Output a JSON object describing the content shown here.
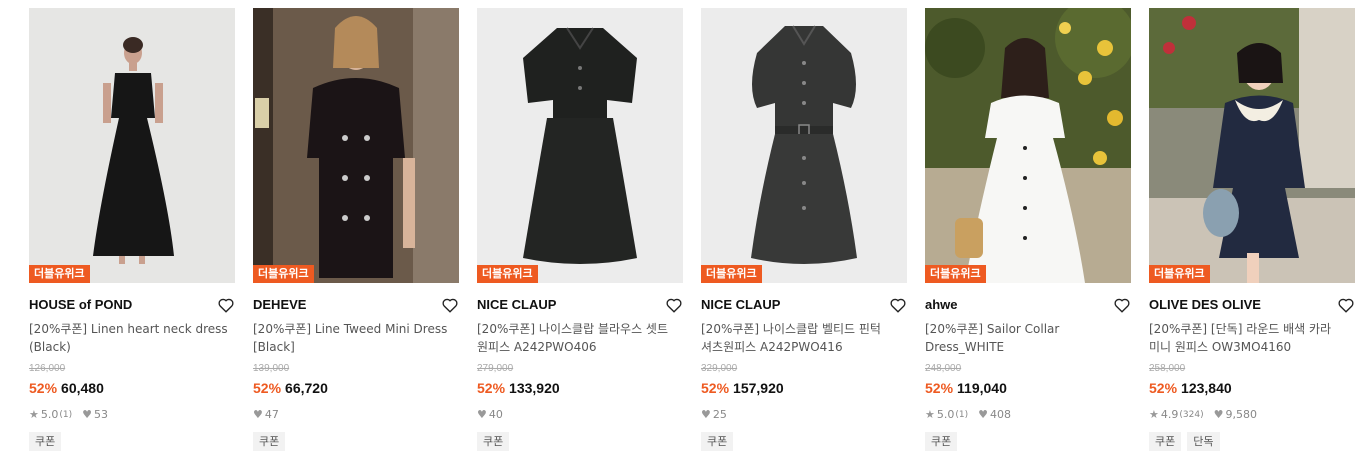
{
  "products": [
    {
      "badge": "더블유위크",
      "brand": "HOUSE of POND",
      "title_line1": "[20%쿠폰] Linen heart neck dress",
      "title_line2": "(Black)",
      "original_price": "126,000",
      "discount": "52%",
      "sale_price": "60,480",
      "rating": "5.0",
      "review_count": "(1)",
      "likes": "53",
      "tags": [
        "쿠폰"
      ],
      "image": "model-black-long-dress"
    },
    {
      "badge": "더블유위크",
      "brand": "DEHEVE",
      "title_line1": "[20%쿠폰] Line Tweed Mini Dress",
      "title_line2": "[Black]",
      "original_price": "139,000",
      "discount": "52%",
      "sale_price": "66,720",
      "rating": "",
      "review_count": "",
      "likes": "47",
      "tags": [
        "쿠폰"
      ],
      "image": "model-black-tweed-mini-dress"
    },
    {
      "badge": "더블유위크",
      "brand": "NICE CLAUP",
      "title_line1": "[20%쿠폰] 나이스클랍 블라우스 셋트",
      "title_line2": "원피스 A242PWO406",
      "original_price": "279,000",
      "discount": "52%",
      "sale_price": "133,920",
      "rating": "",
      "review_count": "",
      "likes": "40",
      "tags": [
        "쿠폰"
      ],
      "image": "product-black-blouse-set-dress"
    },
    {
      "badge": "더블유위크",
      "brand": "NICE CLAUP",
      "title_line1": "[20%쿠폰] 나이스클랍 벨티드 핀턱",
      "title_line2": "셔츠원피스 A242PWO416",
      "original_price": "329,000",
      "discount": "52%",
      "sale_price": "157,920",
      "rating": "",
      "review_count": "",
      "likes": "25",
      "tags": [
        "쿠폰"
      ],
      "image": "product-charcoal-belted-shirt-dress"
    },
    {
      "badge": "더블유위크",
      "brand": "ahwe",
      "title_line1": "[20%쿠폰] Sailor Collar",
      "title_line2": "Dress_WHITE",
      "original_price": "248,000",
      "discount": "52%",
      "sale_price": "119,040",
      "rating": "5.0",
      "review_count": "(1)",
      "likes": "408",
      "tags": [
        "쿠폰"
      ],
      "image": "model-white-sailor-dress-garden"
    },
    {
      "badge": "더블유위크",
      "brand": "OLIVE DES OLIVE",
      "title_line1": "[20%쿠폰] [단독] 라운드 배색 카라",
      "title_line2": "미니 원피스 OW3MO4160",
      "original_price": "258,000",
      "discount": "52%",
      "sale_price": "123,840",
      "rating": "4.9",
      "review_count": "(324)",
      "likes": "9,580",
      "tags": [
        "쿠폰",
        "단독"
      ],
      "image": "model-navy-collar-mini-dress"
    }
  ],
  "icons": {
    "star": "star-icon",
    "heart_small": "heart-icon",
    "wishlist": "heart-outline-icon"
  },
  "colors": {
    "accent": "#ee5a21",
    "badge_bg": "#ee5a21",
    "tag_bg": "#f2f2f2"
  }
}
